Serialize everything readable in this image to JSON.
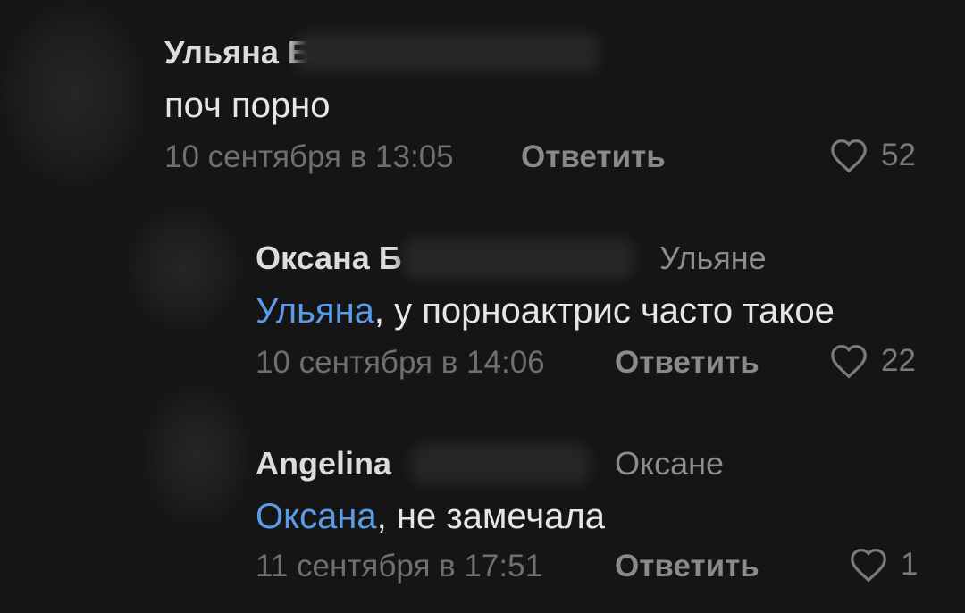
{
  "comments": [
    {
      "author": "Ульяна Б",
      "reply_to": "",
      "mention": "",
      "text": "поч порно",
      "date": "10 сентября в 13:05",
      "reply_label": "Ответить",
      "likes": "52"
    },
    {
      "author": "Оксана Б",
      "reply_to": "Ульяне",
      "mention": "Ульяна",
      "text": ", у порноактрис часто такое",
      "date": "10 сентября в 14:06",
      "reply_label": "Ответить",
      "likes": "22"
    },
    {
      "author": "Angelina",
      "reply_to": "Оксане",
      "mention": "Оксана",
      "text": ", не замечала",
      "date": "11 сентября в 17:51",
      "reply_label": "Ответить",
      "likes": "1"
    }
  ],
  "icons": {
    "like": "heart-outline-icon"
  },
  "colors": {
    "background": "#151515",
    "mention": "#5a9be8",
    "meta": "#6f6f6f"
  }
}
